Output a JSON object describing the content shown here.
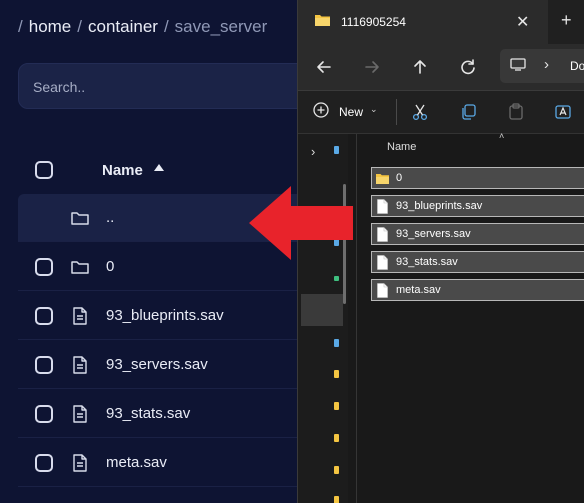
{
  "breadcrumb": {
    "sep": "/",
    "home": "home",
    "container": "container",
    "current": "save_server"
  },
  "search": {
    "placeholder": "Search.."
  },
  "table": {
    "name_header": "Name",
    "rows": [
      {
        "label": "..",
        "icon": "folder-icon"
      },
      {
        "label": "0",
        "icon": "folder-icon"
      },
      {
        "label": "93_blueprints.sav",
        "icon": "file-icon"
      },
      {
        "label": "93_servers.sav",
        "icon": "file-icon"
      },
      {
        "label": "93_stats.sav",
        "icon": "file-icon"
      },
      {
        "label": "meta.sav",
        "icon": "file-icon"
      }
    ]
  },
  "explorer": {
    "tab_title": "1116905254",
    "close": "✕",
    "new_tab": "+",
    "address_partial": "Do",
    "address_chevron": "›",
    "new_label": "New",
    "name_header": "Name",
    "items": [
      {
        "label": "0",
        "icon": "folder-icon"
      },
      {
        "label": "93_blueprints.sav",
        "icon": "file-icon"
      },
      {
        "label": "93_servers.sav",
        "icon": "file-icon"
      },
      {
        "label": "93_stats.sav",
        "icon": "file-icon"
      },
      {
        "label": "meta.sav",
        "icon": "file-icon"
      }
    ]
  },
  "colors": {
    "page_bg": "#0e1433",
    "arrow": "#e8232b",
    "folder": "#f4c542",
    "explorer_bg": "#191919"
  }
}
